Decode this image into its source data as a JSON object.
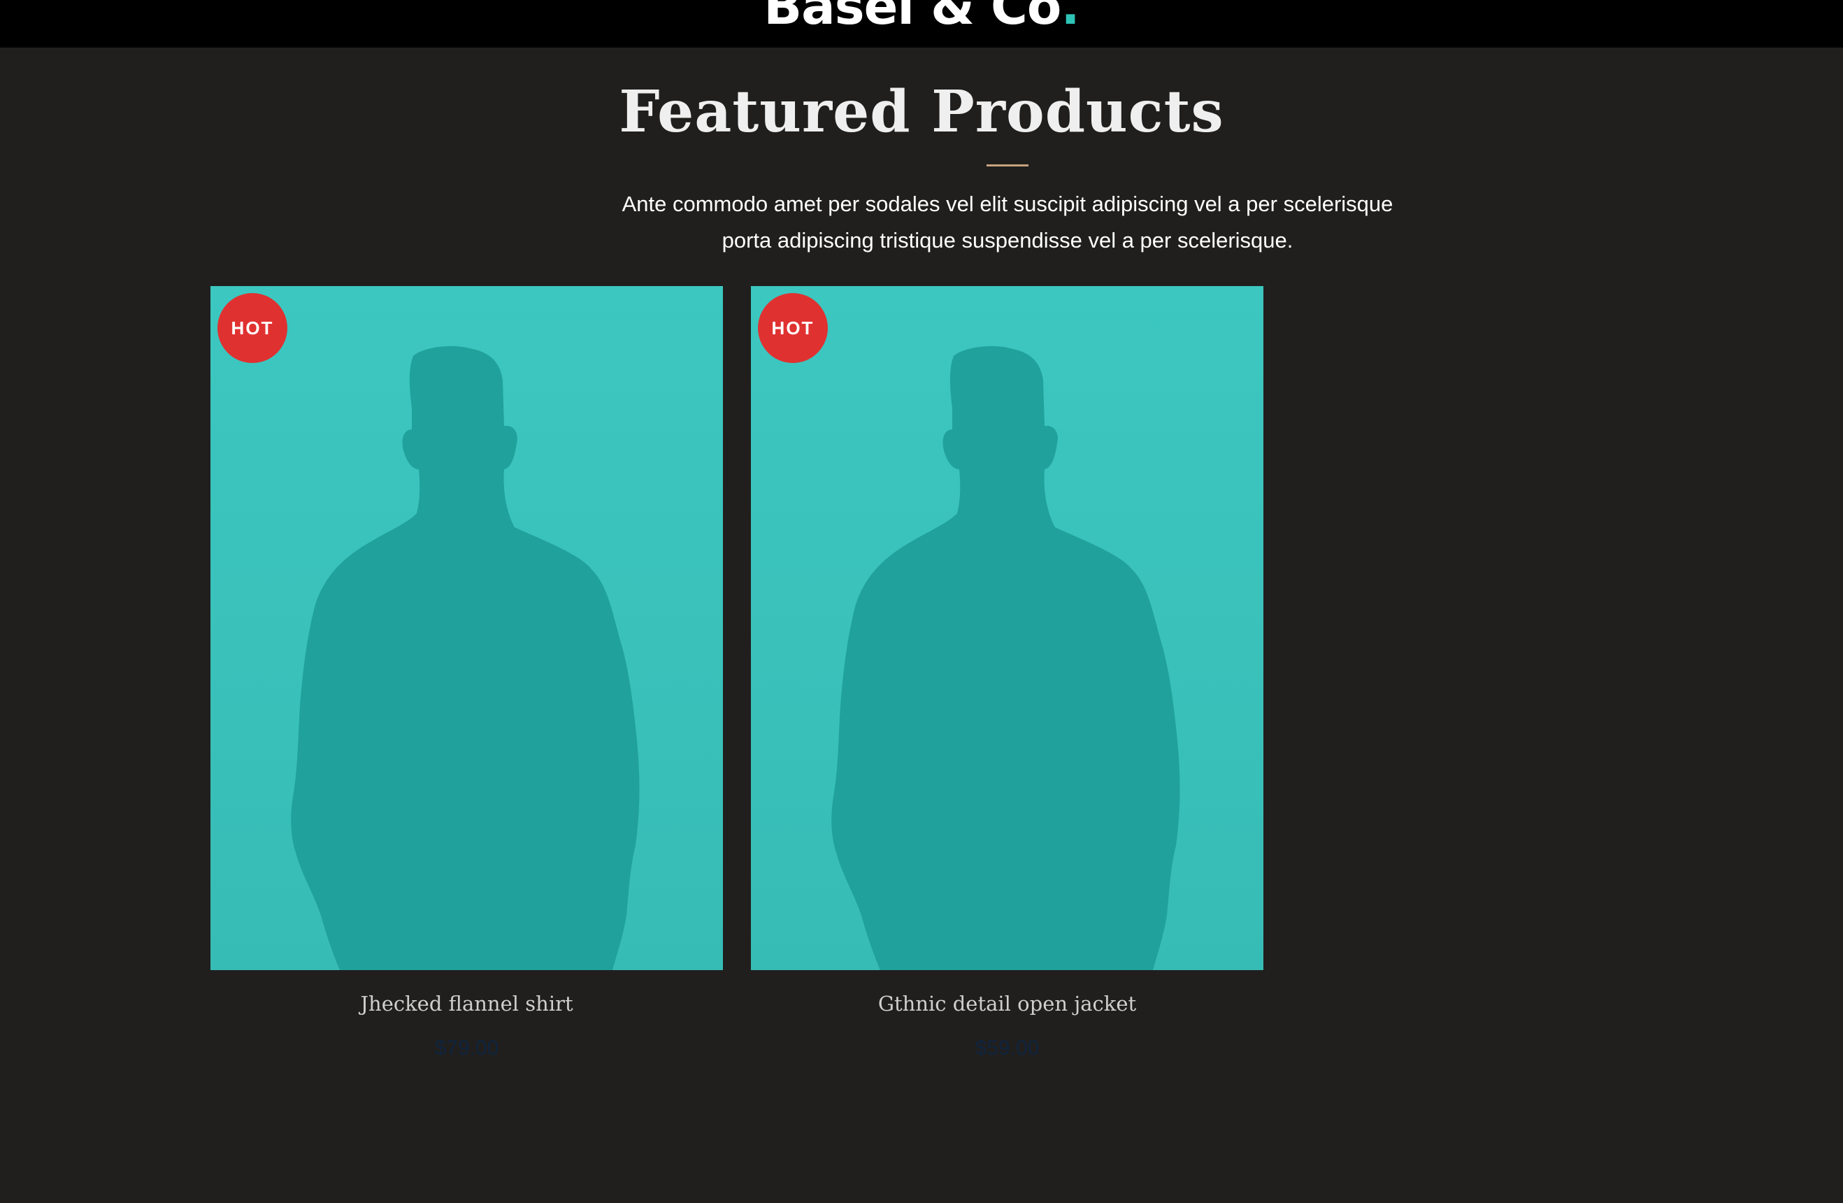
{
  "header": {
    "brand_name": "Basel & Co",
    "brand_dot": "."
  },
  "section": {
    "title": "Featured Products",
    "description": "Ante commodo amet per sodales vel elit suscipit adipiscing vel a per scelerisque porta adipiscing tristique suspendisse vel a per scelerisque."
  },
  "products": [
    {
      "badge": "HOT",
      "name": "Jhecked flannel shirt",
      "price": "$79.00",
      "image_icon": "person-silhouette-icon"
    },
    {
      "badge": "HOT",
      "name": "Gthnic detail open jacket",
      "price": "$59.00",
      "image_icon": "person-silhouette-icon"
    }
  ],
  "colors": {
    "page_background": "#201f1e",
    "header_background": "#000000",
    "accent_teal": "#2ec4b6",
    "image_background": "#3cc7c0",
    "silhouette": "#21a19b",
    "badge_red": "#e03131",
    "divider_gold": "#c9a27e",
    "price_navy": "#10243d"
  }
}
